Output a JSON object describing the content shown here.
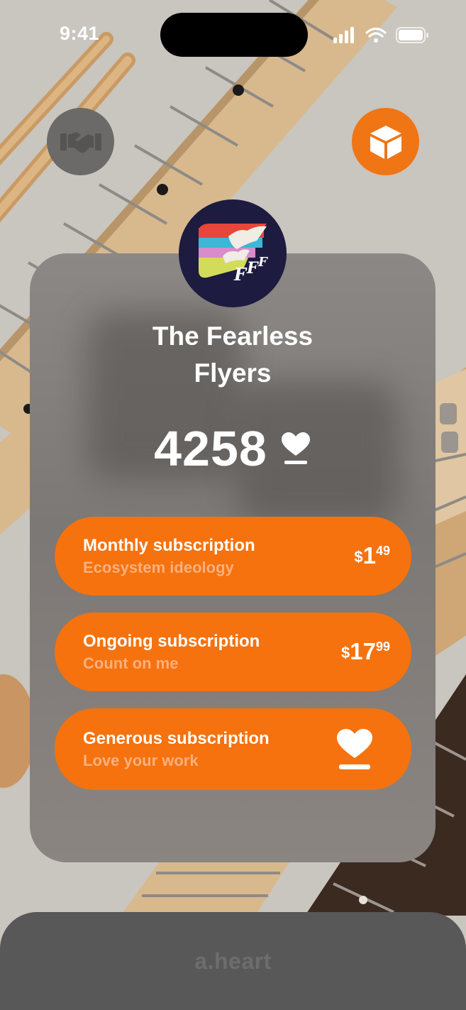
{
  "status_bar": {
    "time": "9:41",
    "icons": [
      "cellular-signal-icon",
      "wifi-icon",
      "battery-icon"
    ]
  },
  "top_buttons": {
    "left_icon": "handshake-icon",
    "right_icon": "box-icon"
  },
  "creator": {
    "name_line1": "The Fearless",
    "name_line2": "Flyers",
    "heart_count": "4258"
  },
  "subscriptions": [
    {
      "title": "Monthly subscription",
      "subtitle": "Ecosystem ideology",
      "currency": "$",
      "dollars": "1",
      "cents": "49"
    },
    {
      "title": "Ongoing subscription",
      "subtitle": "Count on me",
      "currency": "$",
      "dollars": "17",
      "cents": "99"
    },
    {
      "title": "Generous subscription",
      "subtitle": "Love your work",
      "icon": "heart-icon"
    }
  ],
  "bottom_bar": {
    "brand": "a.heart"
  },
  "colors": {
    "accent": "#f5720e",
    "card": "#868380",
    "background": "#c9c5bf",
    "bottom_bar": "#585858"
  }
}
